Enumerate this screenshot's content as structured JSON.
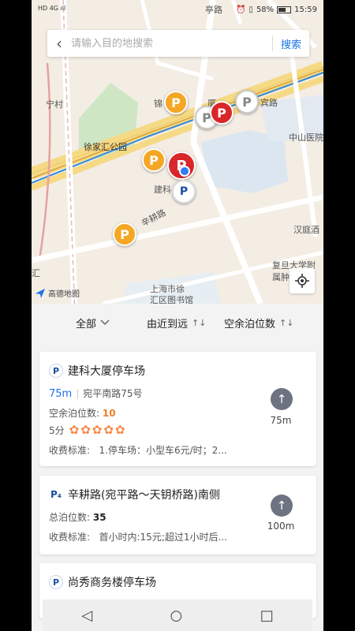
{
  "status": {
    "left": "HD 4G ıll",
    "battery": "58%",
    "time": "15:59"
  },
  "search": {
    "placeholder": "请输入目的地搜索",
    "button": "搜索"
  },
  "map": {
    "labels": {
      "ning_cun": "宁村",
      "jin": "锦",
      "sha": "厦",
      "bin_lu": "宾路",
      "xujiahui_park": "徐家汇公园",
      "zhongshan": "中山医院",
      "jianke": "建科",
      "xingeng": "辛耕路",
      "handing": "汉庭酒",
      "fudan": "复旦大学附属肿瘤医",
      "fudan_l1": "复旦大学附",
      "fudan_l2": "属肿瘤医",
      "library_l1": "上海市徐",
      "library_l2": "汇区图书馆",
      "hui": "汇",
      "ting_lu": "亭路",
      "amap": "高德地图"
    },
    "pin_letter": "P",
    "pin_letter_alt": "P₍A₎"
  },
  "sort": {
    "all": "全部",
    "near": "由近到远",
    "spaces": "空余泊位数"
  },
  "cards": [
    {
      "title": "建科大厦停车场",
      "distance": "75m",
      "address": "宛平南路75号",
      "spaces_label": "空余泊位数: ",
      "spaces_value": "10",
      "score": "5分",
      "fee_label": "收费标准:",
      "fee": "1.停车场：小型车6元/时；2...",
      "nav_distance": "75m"
    },
    {
      "title": "辛耕路(宛平路～天钥桥路)南侧",
      "total_label": "总泊位数: ",
      "total_value": "35",
      "fee_label": "收费标准:",
      "fee": "首小时内:15元;超过1小时后...",
      "nav_distance": "100m"
    },
    {
      "title": "尚秀商务楼停车场"
    }
  ],
  "colors": {
    "accent": "#1a73e8",
    "orange": "#f5a623",
    "red": "#d9262a"
  }
}
